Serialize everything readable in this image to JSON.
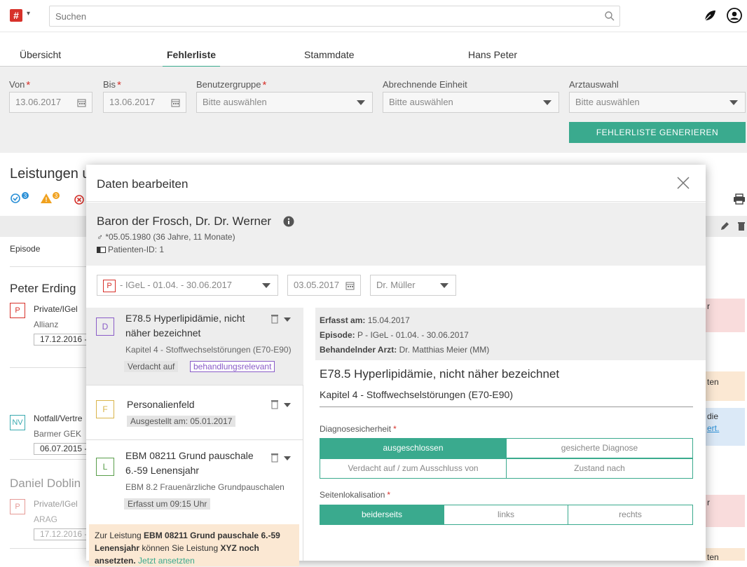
{
  "topbar": {
    "logo_glyph": "#",
    "search_placeholder": "Suchen",
    "icons": [
      "search-icon",
      "leaf-icon",
      "user-icon"
    ]
  },
  "tabs": [
    {
      "label": "Übersicht",
      "active": false
    },
    {
      "label": "Fehlerliste",
      "active": true
    },
    {
      "label": "Stammdate",
      "active": false
    },
    {
      "label": "Hans Peter",
      "active": false
    }
  ],
  "filters": {
    "von_label": "Von",
    "von_value": "13.06.2017",
    "bis_label": "Bis",
    "bis_value": "13.06.2017",
    "gruppe_label": "Benutzergruppe",
    "gruppe_value": "Bitte auswählen",
    "einheit_label": "Abrechnende Einheit",
    "einheit_value": "Bitte auswählen",
    "arzt_label": "Arztauswahl",
    "arzt_value": "Bitte auswählen",
    "generate_button": "FEHLERLISTE GENERIEREN"
  },
  "background": {
    "title": "Leistungen u",
    "badges": [
      "3",
      "3"
    ],
    "episode_label": "Episode",
    "patients": [
      {
        "name": "Peter Erding",
        "entries": [
          {
            "badge": "P",
            "type": "Private/IGel",
            "insurer": "Allianz",
            "date": "17.12.2016 -"
          },
          {
            "badge": "NV",
            "type": "Notfall/Vertre",
            "insurer": "Barmer GEK",
            "date": "06.07.2015 -"
          }
        ]
      },
      {
        "name": "Daniel Doblin",
        "entries": [
          {
            "badge": "P",
            "type": "Private/IGel",
            "insurer": "ARAG",
            "date": "17.12.2016 -"
          }
        ]
      }
    ],
    "right_snippets": [
      "r",
      "ten",
      "die",
      "ert.",
      "r",
      "ten"
    ]
  },
  "modal": {
    "title": "Daten bearbeiten",
    "patient": {
      "name": "Baron der Frosch, Dr. Dr. Werner",
      "birth": "*05.05.1980 (36 Jahre, 11 Monate)",
      "id": "Patienten-ID: 1"
    },
    "episode_select": {
      "badge": "P",
      "value": "- IGeL - 01.04. - 30.06.2017"
    },
    "date_value": "03.05.2017",
    "doctor_value": "Dr. Müller",
    "items": [
      {
        "badge": "D",
        "title": "E78.5 Hyperlipidämie, nicht näher bezeichnet",
        "sub": "Kapitel 4 - Stoffwechselstörungen (E70-E90)",
        "tags": [
          "Verdacht auf",
          "behandlungsrelevant"
        ],
        "color": "#8a5cc7"
      },
      {
        "badge": "F",
        "title": "Personalienfeld",
        "sub": "",
        "tags": [
          "Ausgestellt am: 05.01.2017"
        ],
        "color": "#d9b44a"
      },
      {
        "badge": "L",
        "title": "EBM 08211 Grund pauschale 6.-59 Lenensjahr",
        "sub": "EBM 8.2 Frauenärzliche Grundpauschalen",
        "tags": [
          "Erfasst um 09:15 Uhr"
        ],
        "color": "#5a9e4b"
      }
    ],
    "hint": {
      "pre": "Zur Leistung ",
      "bold1": "EBM 08211 Grund pauschale 6.-59 Lenensjahr",
      "mid": " können Sie Leistung ",
      "bold2": "XYZ noch ansetzten.",
      "link": "Jetzt ansetzten"
    },
    "detail": {
      "erfasst_label": "Erfasst am:",
      "erfasst_value": "15.04.2017",
      "episode_label": "Episode:",
      "episode_value": "P - IGeL - 01.04. - 30.06.2017",
      "arzt_label": "Behandelnder Arzt:",
      "arzt_value": "Dr. Matthias Meier (MM)",
      "title": "E78.5 Hyperlipidämie, nicht näher bezeichnet",
      "subtitle": "Kapitel 4 - Stoffwechselstörungen (E70-E90)",
      "diag_label": "Diagnosesicherheit",
      "diag_options": [
        "ausgeschlossen",
        "gesicherte Diagnose",
        "Verdacht auf / zum Ausschluss von",
        "Zustand nach"
      ],
      "diag_selected": "ausgeschlossen",
      "seite_label": "Seitenlokalisation",
      "seite_options": [
        "beiderseits",
        "links",
        "rechts"
      ],
      "seite_selected": "beiderseits"
    }
  },
  "colors": {
    "accent": "#3aaa8e",
    "danger": "#d7312a",
    "warning": "#f0a11e"
  }
}
